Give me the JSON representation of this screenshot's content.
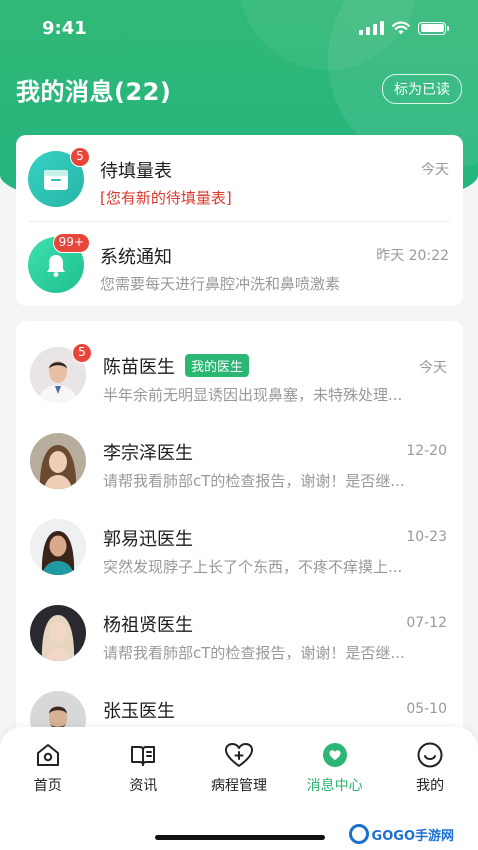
{
  "status_bar": {
    "time": "9:41"
  },
  "header": {
    "title": "我的消息(22)",
    "mark_read_label": "标为已读"
  },
  "system_messages": [
    {
      "name": "待填量表",
      "badge": "5",
      "time": "今天",
      "preview": "[您有新的待填量表]",
      "icon": "clipboard-icon"
    },
    {
      "name": "系统通知",
      "badge": "99+",
      "time": "昨天 20:22",
      "preview": "您需要每天进行鼻腔冲洗和鼻喷激素",
      "icon": "bell-icon"
    }
  ],
  "doctor_messages": [
    {
      "name": "陈苗医生",
      "tag": "我的医生",
      "badge": "5",
      "time": "今天",
      "preview": "半年余前无明显诱因出现鼻塞，未特殊处理..."
    },
    {
      "name": "李宗泽医生",
      "tag": "",
      "badge": "",
      "time": "12-20",
      "preview": "请帮我看肺部cT的检查报告，谢谢！是否继..."
    },
    {
      "name": "郭易迅医生",
      "tag": "",
      "badge": "",
      "time": "10-23",
      "preview": "突然发现脖子上长了个东西，不疼不痒摸上..."
    },
    {
      "name": "杨祖贤医生",
      "tag": "",
      "badge": "",
      "time": "07-12",
      "preview": "请帮我看肺部cT的检查报告，谢谢！是否继..."
    },
    {
      "name": "张玉医生",
      "tag": "",
      "badge": "",
      "time": "05-10",
      "preview": ""
    }
  ],
  "tabbar": {
    "items": [
      {
        "label": "首页",
        "icon": "home-icon",
        "active": false
      },
      {
        "label": "资讯",
        "icon": "book-icon",
        "active": false
      },
      {
        "label": "病程管理",
        "icon": "heart-plus-icon",
        "active": false
      },
      {
        "label": "消息中心",
        "icon": "message-icon",
        "active": true
      },
      {
        "label": "我的",
        "icon": "smile-icon",
        "active": false
      }
    ]
  },
  "watermark": {
    "text": "GOGO手游网"
  },
  "colors": {
    "primary": "#2bb673",
    "badge": "#e8463b",
    "alert_text": "#d9392f"
  }
}
